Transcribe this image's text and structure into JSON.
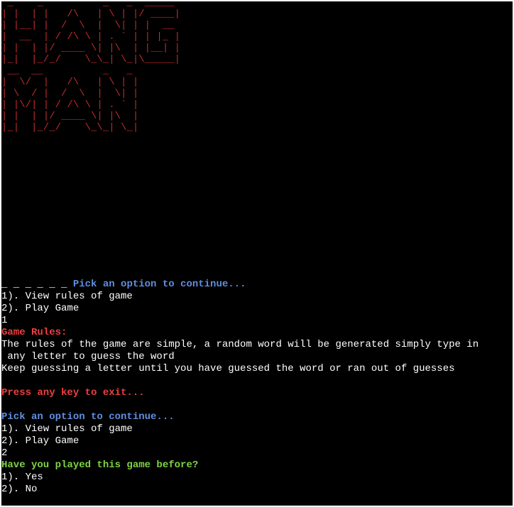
{
  "banner": {
    "ascii_art": " _    _          _   _  _____ \n| |  | |   /\\   | \\ | |/ ____|\n| |__| |  /  \\  |  \\| | |  __ \n|  __  | / /\\ \\ | . ` | | |_ |\n| |  | |/ ____ \\| |\\  | |__| |\n|_|  |_/_/    \\_\\_| \\_|\\_____|\n __  __          _   _ \n|  \\/  |   /\\   | \\ | |\n| \\  / |  /  \\  |  \\| |\n| |\\/| | / /\\ \\ | . ` |\n| |  | |/ ____ \\| |\\  |\n|_|  |_/_/    \\_\\_| \\_|"
  },
  "console": {
    "first_prompt": {
      "blanks": "_ _ _ _ _ _ ",
      "text": "Pick an option to continue..."
    },
    "first_menu": {
      "option_1": "1). View rules of game",
      "option_2": "2). Play Game"
    },
    "first_input": "1",
    "rules": {
      "heading": "Game Rules:",
      "line_1": "The rules of the game are simple, a random word will be generated simply type in",
      "line_2": " any letter to guess the word",
      "line_3": "Keep guessing a letter until you have guessed the word or ran out of guesses"
    },
    "exit_prompt": "Press any key to exit...",
    "second_prompt": "Pick an option to continue...",
    "second_menu": {
      "option_1": "1). View rules of game",
      "option_2": "2). Play Game"
    },
    "second_input": "2",
    "played_before": {
      "question": "Have you played this game before?",
      "option_1": "1). Yes",
      "option_2": "2). No"
    }
  },
  "colors": {
    "background": "#000000",
    "banner": "#c22a2a",
    "prompt_blue": "#5f8fe0",
    "heading_red": "#ef3f3f",
    "question_green": "#7dd444",
    "text_white": "#ffffff"
  }
}
